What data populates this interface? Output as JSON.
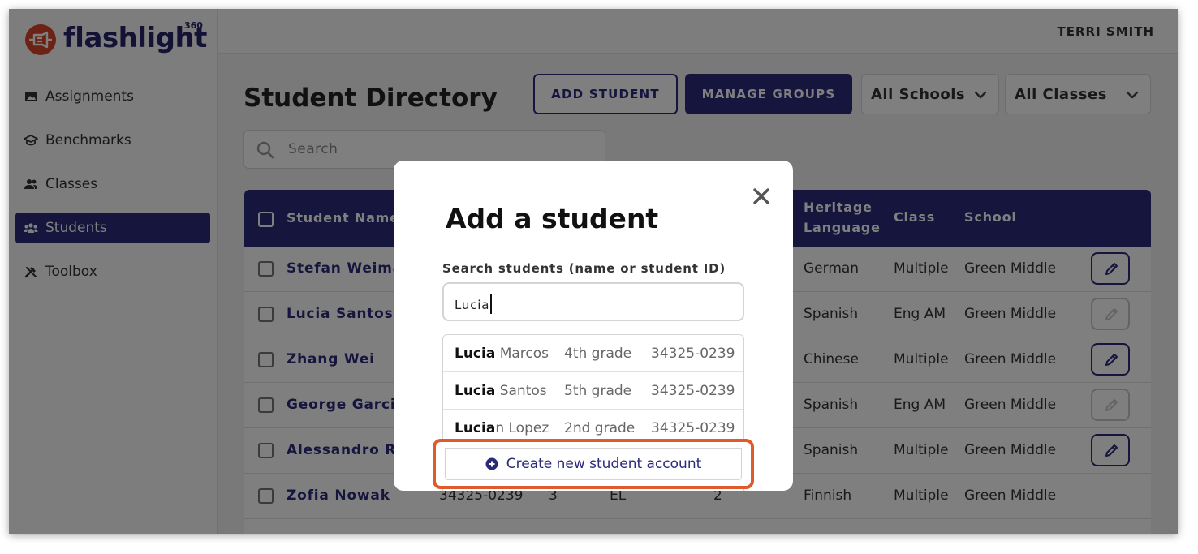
{
  "brand": {
    "name": "flashlight",
    "superscript": "360",
    "color": "#d9442b"
  },
  "user": {
    "name": "TERRI SMITH"
  },
  "sidebar": {
    "items": [
      {
        "label": "Assignments",
        "icon": "image-icon",
        "active": false
      },
      {
        "label": "Benchmarks",
        "icon": "graduation-icon",
        "active": false
      },
      {
        "label": "Classes",
        "icon": "people-icon",
        "active": false
      },
      {
        "label": "Students",
        "icon": "group-icon",
        "active": true
      },
      {
        "label": "Toolbox",
        "icon": "tools-icon",
        "active": false
      }
    ]
  },
  "main": {
    "title": "Student Directory",
    "add_student_label": "ADD STUDENT",
    "manage_groups_label": "MANAGE GROUPS",
    "schools_filter": "All Schools",
    "classes_filter": "All Classes",
    "search_placeholder": "Search",
    "accent_color": "#2b2a7a"
  },
  "table": {
    "headers": [
      "Student Name",
      "Heritage Language",
      "Class",
      "School"
    ],
    "rows": [
      {
        "name": "Stefan Weima",
        "id": "",
        "grade": "",
        "program": "",
        "level": "",
        "language": "German",
        "class": "Multiple",
        "school": "Green Middle",
        "editable": true
      },
      {
        "name": "Lucia Santos",
        "id": "",
        "grade": "",
        "program": "",
        "level": "",
        "language": "Spanish",
        "class": "Eng AM",
        "school": "Green Middle",
        "editable": false
      },
      {
        "name": "Zhang Wei",
        "id": "",
        "grade": "",
        "program": "",
        "level": "",
        "language": "Chinese",
        "class": "Multiple",
        "school": "Green Middle",
        "editable": true
      },
      {
        "name": "George Garcia",
        "id": "",
        "grade": "",
        "program": "",
        "level": "",
        "language": "Spanish",
        "class": "Eng AM",
        "school": "Green Middle",
        "editable": false
      },
      {
        "name": "Alessandro Ri",
        "id": "",
        "grade": "",
        "program": "",
        "level": "",
        "language": "Spanish",
        "class": "Multiple",
        "school": "Green Middle",
        "editable": true
      },
      {
        "name": "Zofia Nowak",
        "id": "34325-0239",
        "grade": "3",
        "program": "EL",
        "level": "2",
        "language": "Finnish",
        "class": "Multiple",
        "school": "Green Middle",
        "editable": false
      }
    ]
  },
  "modal": {
    "title": "Add a student",
    "search_label": "Search students (name or student ID)",
    "search_value": "Lucia",
    "results": [
      {
        "match": "Lucia",
        "rest": " Marcos",
        "grade": "4th grade",
        "id": "34325-0239"
      },
      {
        "match": "Lucia",
        "rest": " Santos",
        "grade": "5th grade",
        "id": "34325-0239"
      },
      {
        "match": "Lucia",
        "rest": "n Lopez",
        "grade": "2nd grade",
        "id": "34325-0239"
      }
    ],
    "create_label": "Create new student account",
    "highlight_color": "#e15a2a"
  }
}
